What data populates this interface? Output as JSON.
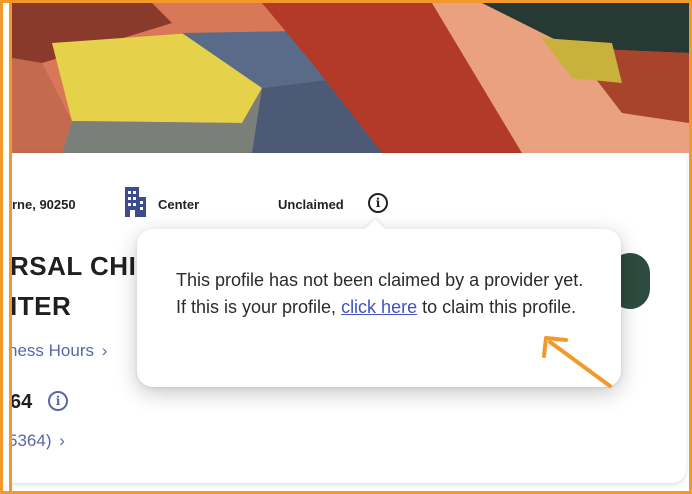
{
  "header": {
    "address_partial": "rne, 90250",
    "type_label": "Center",
    "claim_status": "Unclaimed",
    "info_icon": "info-icon",
    "building_icon": "building-icon"
  },
  "provider": {
    "title_line1": "RSAL CHIL",
    "title_line2": "ITER",
    "hours_link": "ness Hours",
    "license_number": "64",
    "license_link": "5364)"
  },
  "tooltip": {
    "text_before": "This profile has not been claimed by a provider yet. If this is your profile, ",
    "link_text": "click here",
    "text_after": " to claim this profile."
  },
  "colors": {
    "frame": "#f3992c",
    "link": "#5a67a8",
    "tooltip_link": "#4351c4",
    "arrow": "#f3992c",
    "action_button": "#2e4b3f"
  }
}
